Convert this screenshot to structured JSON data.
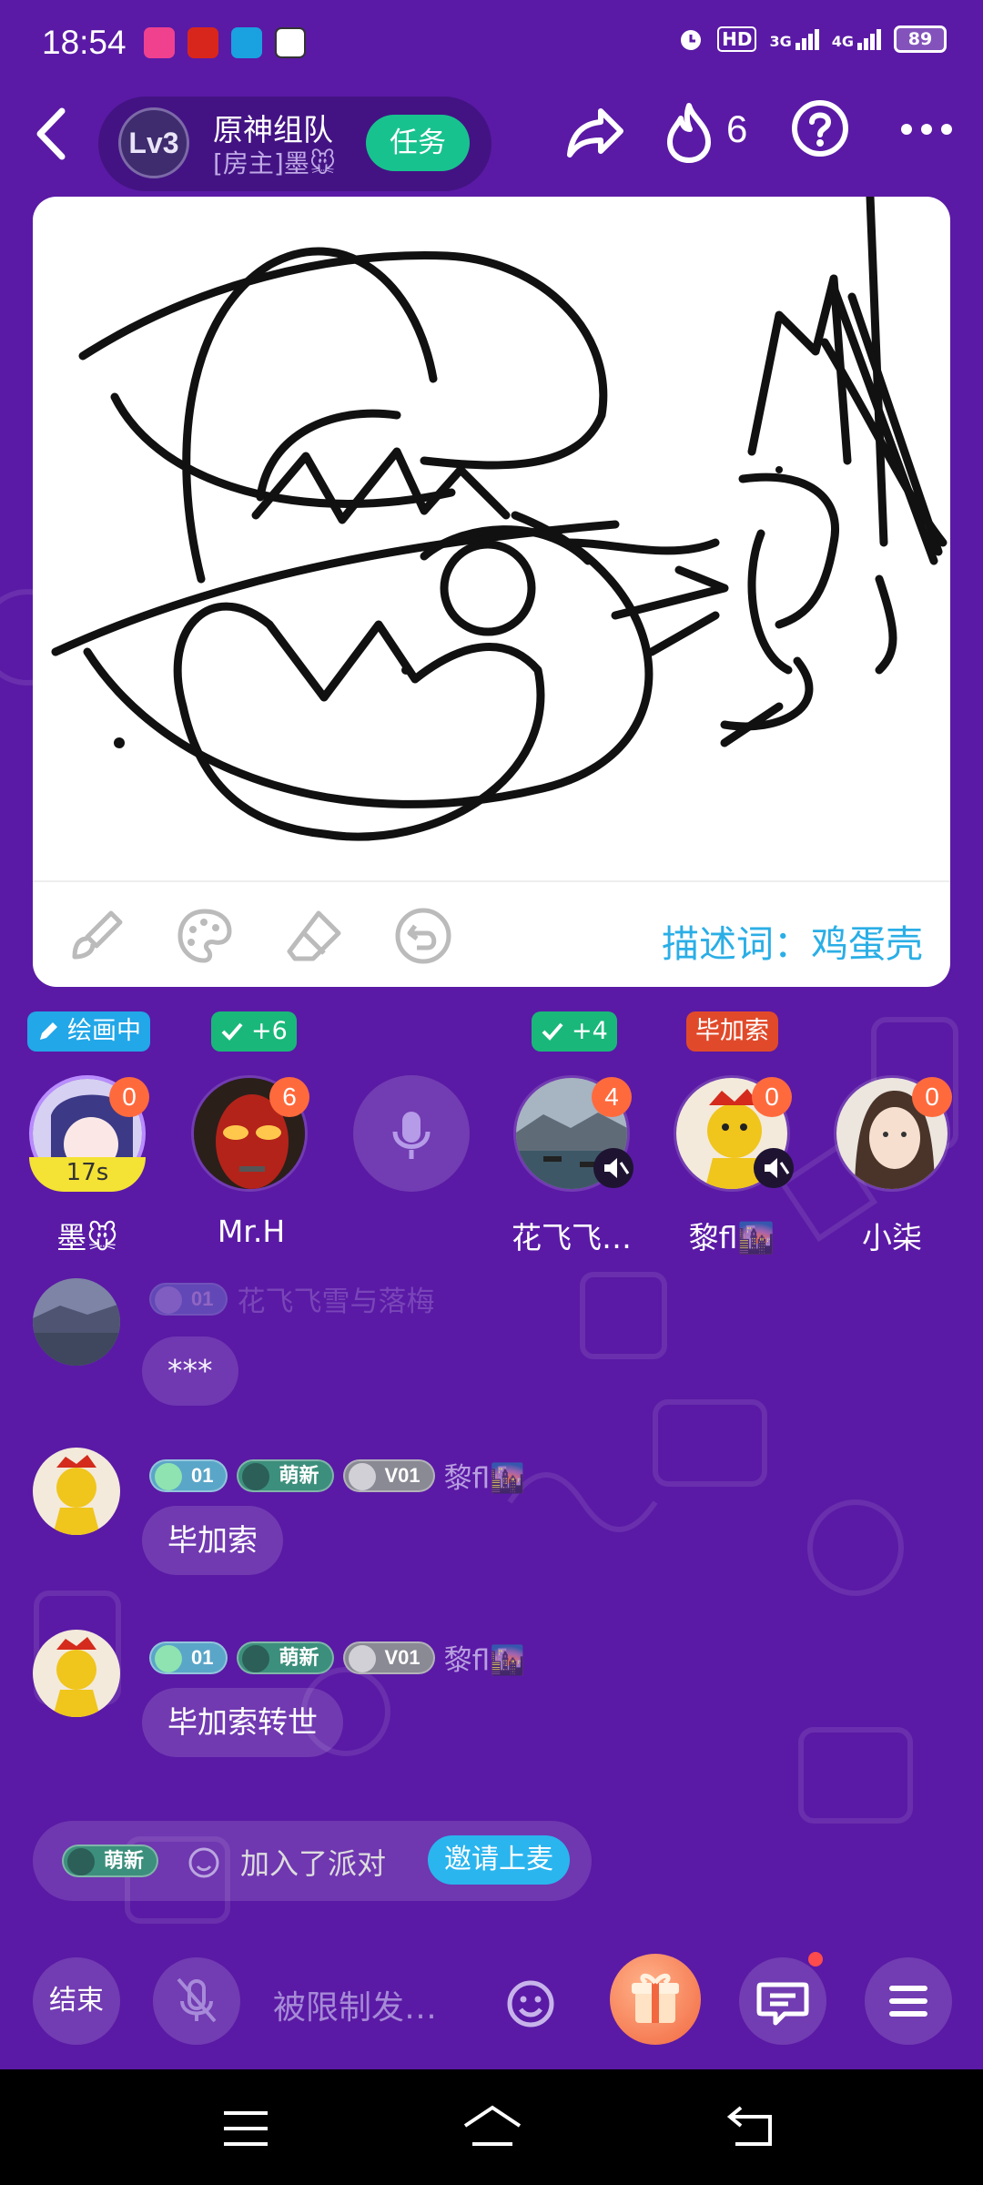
{
  "status_bar": {
    "time": "18:54",
    "network_1": "HD",
    "network_2": "3G",
    "network_3": "4G",
    "battery": "89"
  },
  "header": {
    "level": "Lv3",
    "room_title": "原神组队",
    "room_host": "[房主]墨🐭",
    "task_label": "任务",
    "hot_count": "6"
  },
  "canvas": {
    "hint_label": "描述词：",
    "hint_word": "鸡蛋壳"
  },
  "seats": [
    {
      "tag": "绘画中",
      "tag_color": "#22a7e8",
      "count": "0",
      "timer": "17s",
      "name": "墨🐭"
    },
    {
      "tag": "+6",
      "tag_color": "#19b87a",
      "count": "6",
      "name": "Mr.H"
    },
    {
      "tag": "",
      "name": ""
    },
    {
      "tag": "+4",
      "tag_color": "#19b87a",
      "count": "4",
      "name": "花飞飞…"
    },
    {
      "tag": "毕加索",
      "tag_color": "#e04a2a",
      "count": "0",
      "name": "黎fl🌆"
    },
    {
      "tag": "",
      "count": "0",
      "name": "小柒"
    }
  ],
  "chat": {
    "messages": [
      {
        "badges": [
          "01"
        ],
        "sender": "花飞飞雪与落梅",
        "text": "***"
      },
      {
        "badges": [
          "01",
          "萌新",
          "V01"
        ],
        "sender": "黎fl🌆",
        "text": "毕加索"
      },
      {
        "badges": [
          "01",
          "萌新",
          "V01"
        ],
        "sender": "黎fl🌆",
        "text": "毕加索转世"
      }
    ],
    "join": {
      "badge": "萌新",
      "text": "加入了派对",
      "invite_label": "邀请上麦"
    }
  },
  "bottom_bar": {
    "end_label": "结束",
    "input_placeholder": "被限制发…"
  },
  "colors": {
    "background": "#5a1aa5",
    "accent_green": "#18c28e",
    "accent_blue": "#2aaee6",
    "badge_orange": "#ff6a3d"
  }
}
